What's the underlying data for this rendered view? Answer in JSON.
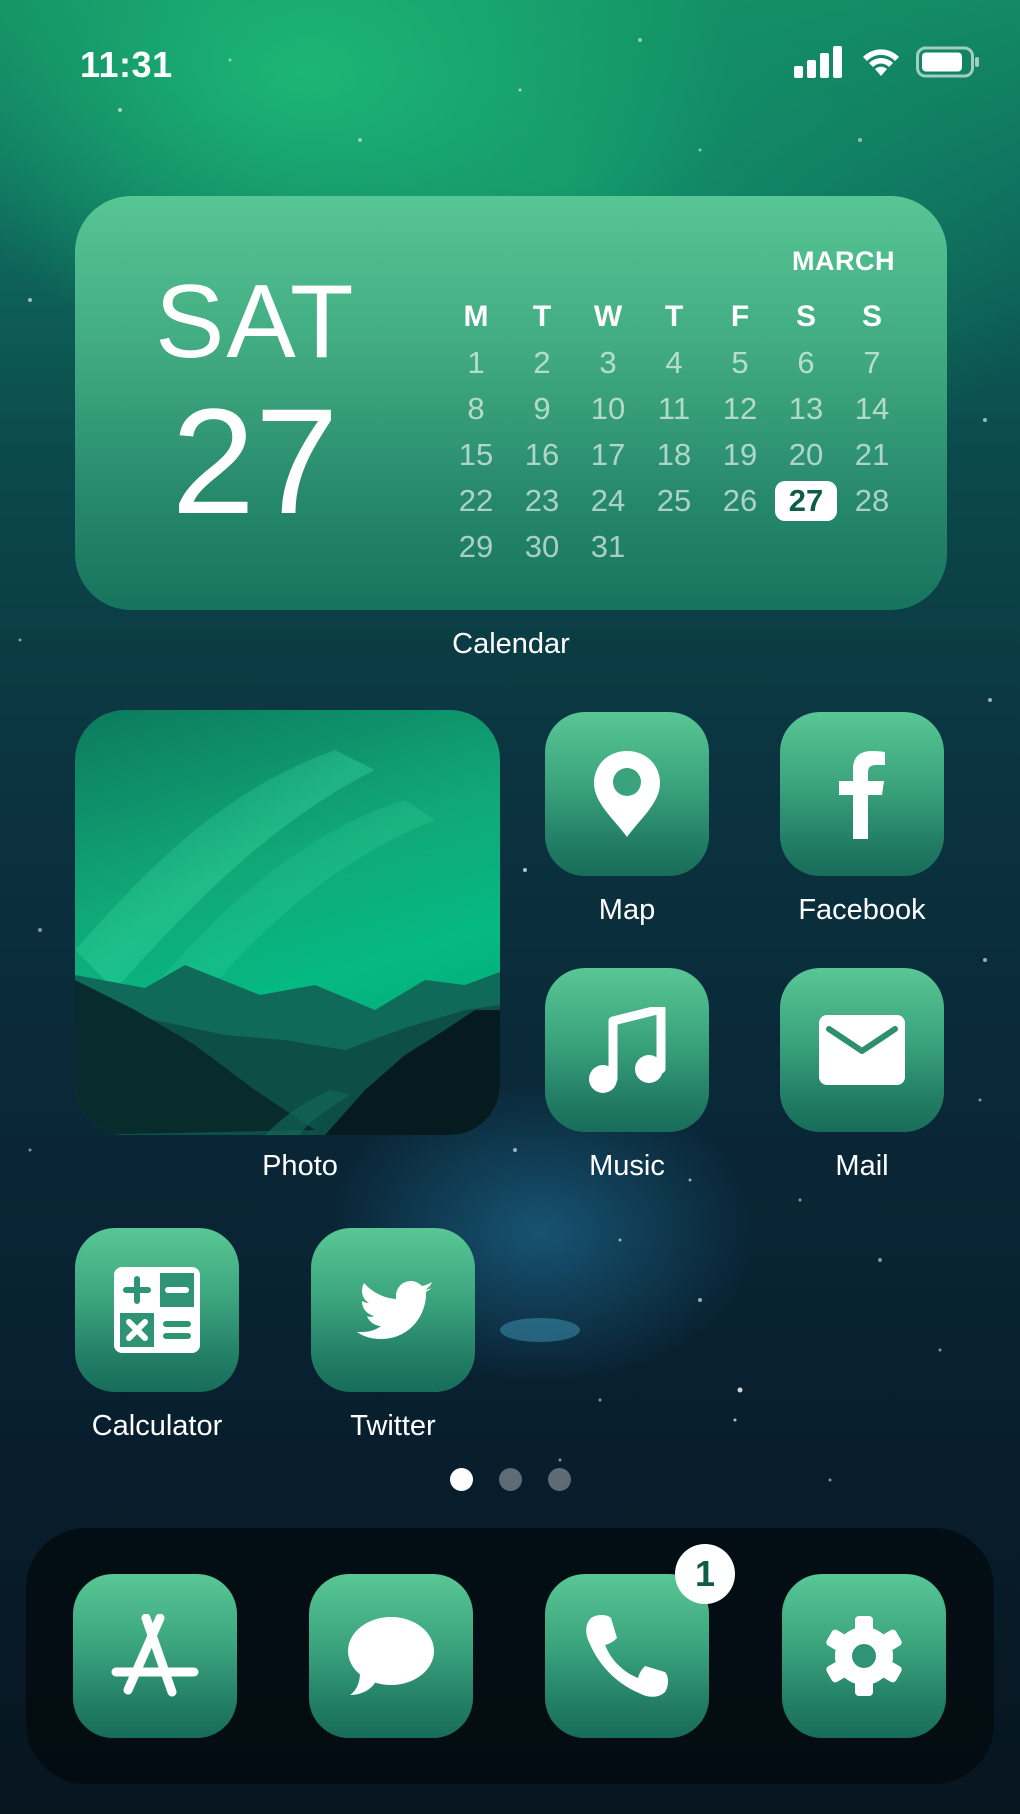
{
  "status_bar": {
    "time": "11:31",
    "signal_icon": "cellular-signal-icon",
    "wifi_icon": "wifi-icon",
    "battery_icon": "battery-icon"
  },
  "calendar_widget": {
    "day_of_week": "SAT",
    "date": "27",
    "month": "MARCH",
    "weekday_headers": [
      "M",
      "T",
      "W",
      "T",
      "F",
      "S",
      "S"
    ],
    "days": [
      [
        "1",
        "2",
        "3",
        "4",
        "5",
        "6",
        "7"
      ],
      [
        "8",
        "9",
        "10",
        "11",
        "12",
        "13",
        "14"
      ],
      [
        "15",
        "16",
        "17",
        "18",
        "19",
        "20",
        "21"
      ],
      [
        "22",
        "23",
        "24",
        "25",
        "26",
        "27",
        "28"
      ],
      [
        "29",
        "30",
        "31",
        "",
        "",
        "",
        ""
      ]
    ],
    "today": "27",
    "label": "Calendar"
  },
  "photo_widget": {
    "label": "Photo"
  },
  "apps": [
    {
      "label": "Map",
      "icon": "map-pin-icon"
    },
    {
      "label": "Facebook",
      "icon": "facebook-icon"
    },
    {
      "label": "Music",
      "icon": "music-note-icon"
    },
    {
      "label": "Mail",
      "icon": "mail-envelope-icon"
    },
    {
      "label": "Calculator",
      "icon": "calculator-icon"
    },
    {
      "label": "Twitter",
      "icon": "twitter-bird-icon"
    }
  ],
  "page_indicator": {
    "total_pages": 3,
    "current_page": 1
  },
  "dock": [
    {
      "name": "App Store",
      "icon": "app-store-icon"
    },
    {
      "name": "Messages",
      "icon": "message-bubble-icon"
    },
    {
      "name": "Phone",
      "icon": "phone-icon",
      "badge": "1"
    },
    {
      "name": "Settings",
      "icon": "gear-icon"
    }
  ],
  "colors": {
    "icon_gradient_top": "#58c794",
    "icon_gradient_bottom": "#186d59",
    "badge_text": "#0f5c48"
  }
}
